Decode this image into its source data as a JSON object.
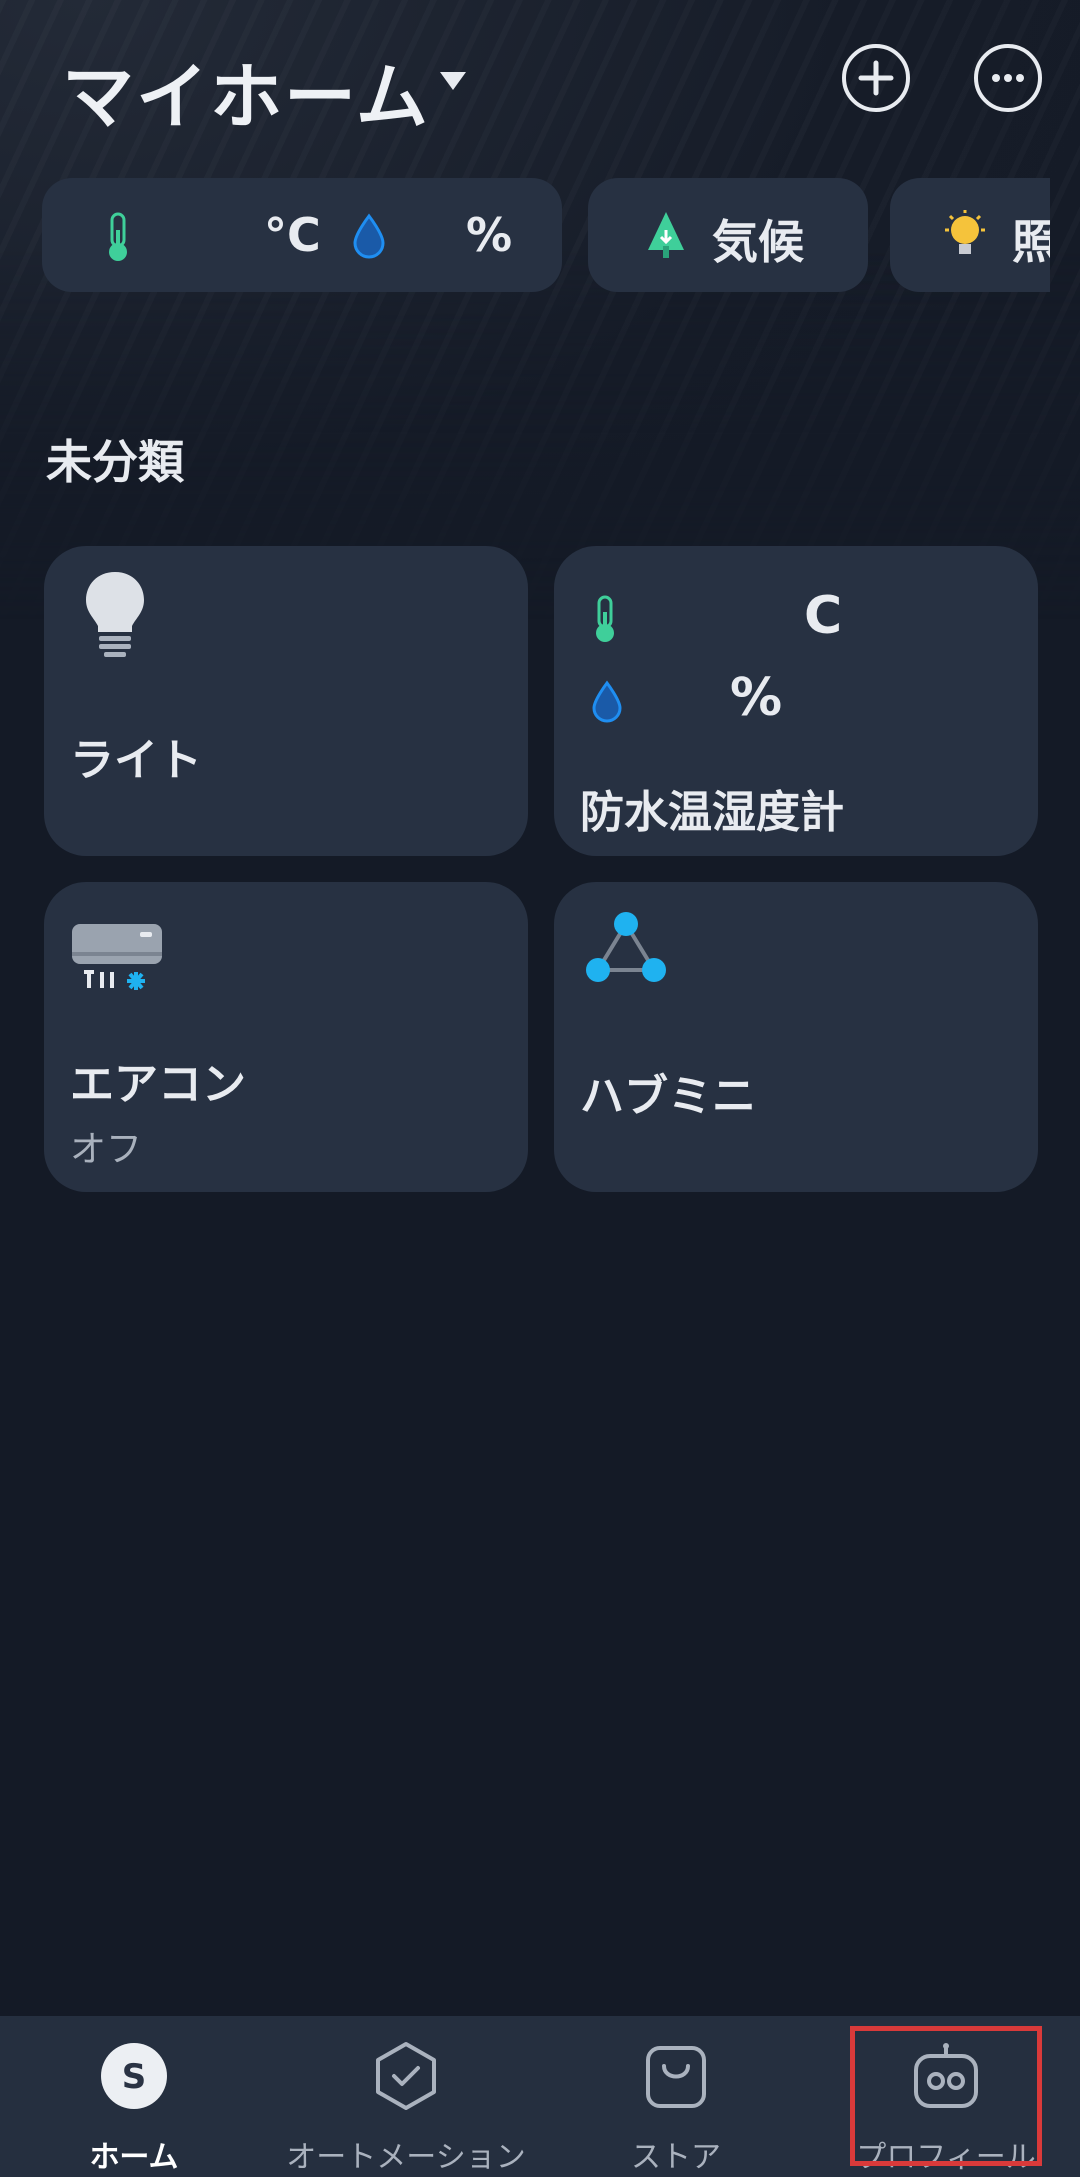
{
  "header": {
    "title": "マイホーム",
    "add_icon": "plus-circle-icon",
    "more_icon": "more-horizontal-icon"
  },
  "chips": [
    {
      "icon": "thermometer-icon",
      "unit": "°C",
      "icon2": "humidity-drop-icon",
      "unit2": "%"
    },
    {
      "icon": "tree-icon",
      "label": "気候"
    },
    {
      "icon": "lightbulb-icon",
      "label": "照"
    }
  ],
  "section": {
    "title": "未分類"
  },
  "devices": [
    {
      "name": "ライト",
      "icon": "lightbulb-icon"
    },
    {
      "name": "防水温湿度計",
      "icon": "thermometer-icon",
      "temp_unit": "C",
      "humidity_unit": "%"
    },
    {
      "name": "エアコン",
      "status": "オフ",
      "icon": "air-conditioner-icon"
    },
    {
      "name": "ハブミニ",
      "icon": "hub-icon"
    }
  ],
  "tabbar": {
    "tabs": [
      {
        "label": "ホーム",
        "icon": "home-s-icon",
        "active": true
      },
      {
        "label": "オートメーション",
        "icon": "automation-icon"
      },
      {
        "label": "ストア",
        "icon": "store-bag-icon"
      },
      {
        "label": "プロフィール",
        "icon": "profile-robot-icon"
      }
    ]
  },
  "colors": {
    "background": "#141a26",
    "card": "#273142",
    "tabbar": "#252f3f",
    "thermo_green": "#3fcf9a",
    "water_blue": "#1f8ef1",
    "hub_blue": "#1fb2f0",
    "bulb_yellow": "#f5c33b",
    "highlight": "#d93a3a"
  }
}
